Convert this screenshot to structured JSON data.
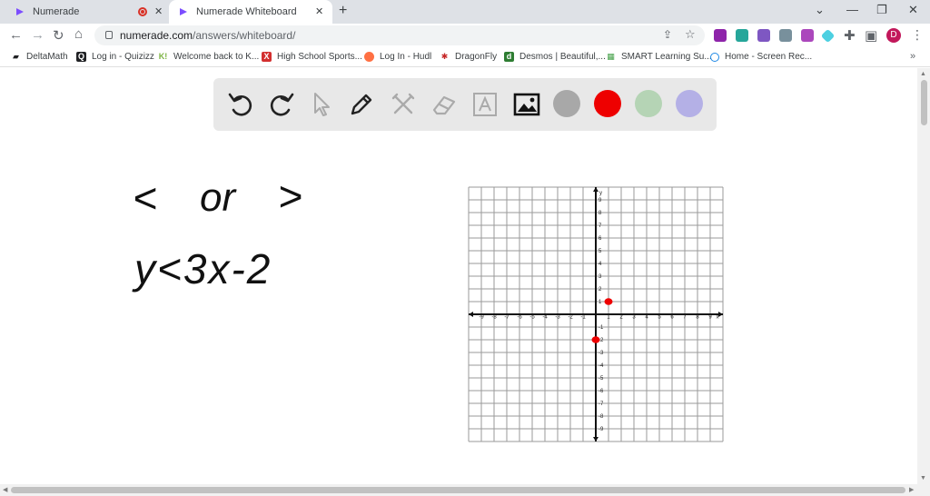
{
  "browser": {
    "tabs": [
      {
        "title": "Numerade",
        "active": false,
        "recording": true
      },
      {
        "title": "Numerade Whiteboard",
        "active": true
      }
    ],
    "url_host": "numerade.com",
    "url_path": "/answers/whiteboard/",
    "profile_initial": "D",
    "bookmarks": [
      "DeltaMath",
      "Log in - Quizizz",
      "Welcome back to K...",
      "High School Sports...",
      "Log In - Hudl",
      "DragonFly",
      "Desmos | Beautiful,...",
      "SMART Learning Su...",
      "Home - Screen Rec..."
    ]
  },
  "whiteboard": {
    "tools": [
      "undo-icon",
      "redo-icon",
      "pointer-icon",
      "pen-icon",
      "tools-icon",
      "eraser-icon",
      "text-icon",
      "image-icon"
    ],
    "colors": [
      "#a8a8a8",
      "#ee0000",
      "#b5d4b5",
      "#b4b0e6"
    ],
    "handwriting": {
      "line1_less": "<",
      "line1_or": "or",
      "line1_greater": ">",
      "line2": "y<3x-2"
    }
  },
  "chart_data": {
    "type": "scatter",
    "title": "",
    "xlabel": "x",
    "ylabel": "y",
    "xlim": [
      -10,
      10
    ],
    "ylim": [
      -10,
      10
    ],
    "grid": true,
    "x_tick_labels": [
      "-9",
      "-8",
      "-7",
      "-6",
      "-5",
      "-4",
      "-3",
      "-2",
      "-1",
      "1",
      "2",
      "3",
      "4",
      "5",
      "6",
      "7",
      "8",
      "9"
    ],
    "y_tick_labels": [
      "9",
      "8",
      "7",
      "6",
      "5",
      "4",
      "3",
      "2",
      "1",
      "-1",
      "-2",
      "-3",
      "-4",
      "-5",
      "-6",
      "-7",
      "-8",
      "-9"
    ],
    "points": [
      {
        "x": 1,
        "y": 1
      },
      {
        "x": 0,
        "y": -2
      }
    ],
    "point_color": "#ee0000"
  }
}
